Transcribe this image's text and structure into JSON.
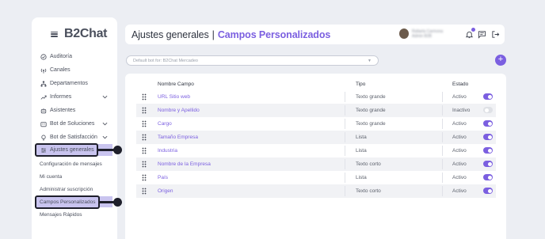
{
  "app": {
    "brand": "B2Chat"
  },
  "sidebar": {
    "items": [
      {
        "label": "Auditoría",
        "icon": "check-circle-icon"
      },
      {
        "label": "Canales",
        "icon": "broadcast-icon"
      },
      {
        "label": "Departamentos",
        "icon": "org-chart-icon"
      },
      {
        "label": "Informes",
        "icon": "trend-icon",
        "expandable": true
      },
      {
        "label": "Asistentes",
        "icon": "robot-icon"
      },
      {
        "label": "Bot de Soluciones",
        "icon": "bot-box-icon",
        "expandable": true
      },
      {
        "label": "Bot de Satisfacción",
        "icon": "bulb-icon",
        "expandable": true
      },
      {
        "label": "Ajustes generales",
        "icon": "sliders-icon",
        "active": true
      }
    ],
    "subitems": [
      {
        "label": "Configuración de mensajes"
      },
      {
        "label": "Mi cuenta"
      },
      {
        "label": "Administrar suscripción"
      },
      {
        "label": "Campos Personalizados",
        "active": true
      },
      {
        "label": "Mensajes Rápidos"
      }
    ]
  },
  "callouts": [
    "1",
    "2"
  ],
  "header": {
    "title": "Ajustes generales",
    "separator": "|",
    "subtitle": "Campos Personalizados",
    "user_name": "Rafaela Carmona",
    "user_role": "Admin B2B",
    "notification_count": "1"
  },
  "bot_select": {
    "value": "Default bot for: B2Chat Mercadeo"
  },
  "add_button": {
    "label": "+"
  },
  "table": {
    "columns": [
      "Nombre Campo",
      "Tipo",
      "Estado"
    ],
    "rows": [
      {
        "name": "URL Sitio web",
        "type": "Texto grande",
        "state": "Activo",
        "on": true
      },
      {
        "name": "Nombre y Apellido",
        "type": "Texto grande",
        "state": "Inactivo",
        "on": false
      },
      {
        "name": "Cargo",
        "type": "Texto grande",
        "state": "Activo",
        "on": true
      },
      {
        "name": "Tamaño Empresa",
        "type": "Lista",
        "state": "Activo",
        "on": true
      },
      {
        "name": "Industria",
        "type": "Lista",
        "state": "Activo",
        "on": true
      },
      {
        "name": "Nombre de la Empresa",
        "type": "Texto corto",
        "state": "Activo",
        "on": true
      },
      {
        "name": "País",
        "type": "Lista",
        "state": "Activo",
        "on": true
      },
      {
        "name": "Origen",
        "type": "Texto corto",
        "state": "Activo",
        "on": true
      }
    ]
  },
  "colors": {
    "accent": "#7b5fe0",
    "dark": "#1e1f2b",
    "active_bg": "#c9c4ef"
  }
}
